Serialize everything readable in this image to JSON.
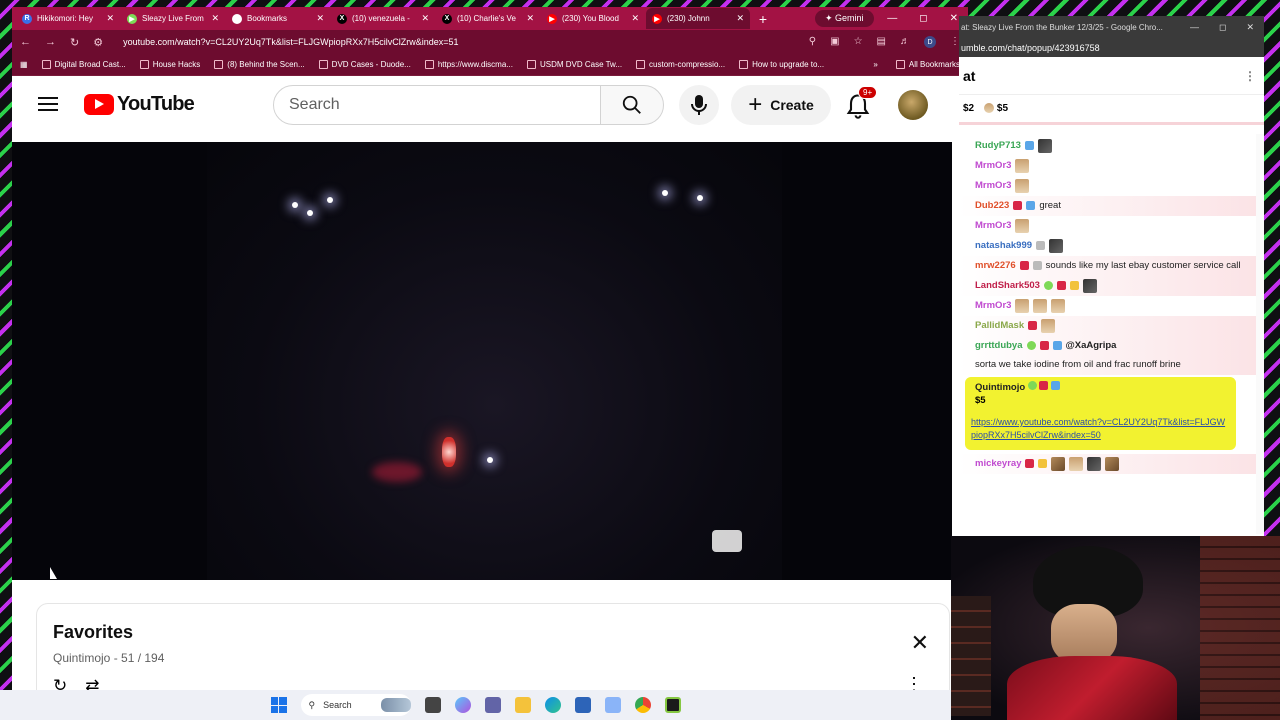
{
  "browser": {
    "tabs": [
      {
        "label": "Hikikomori: Hey",
        "favicon": "R",
        "favcolor": "#3a6fe8",
        "active": false
      },
      {
        "label": "Sleazy Live From",
        "favicon": "▶",
        "favcolor": "#7ed957",
        "active": false
      },
      {
        "label": "Bookmarks",
        "favicon": "★",
        "favcolor": "#ffffff",
        "active": false
      },
      {
        "label": "(10) venezuela -",
        "favicon": "X",
        "favcolor": "#000000",
        "active": false
      },
      {
        "label": "(10) Charlie's Ve",
        "favicon": "X",
        "favcolor": "#000000",
        "active": false
      },
      {
        "label": "(230) You Blood",
        "favicon": "▶",
        "favcolor": "#ff0000",
        "active": false
      },
      {
        "label": "(230) Johnn",
        "favicon": "▶",
        "favcolor": "#ff0000",
        "active": true
      }
    ],
    "new_tab": "+",
    "gemini": "✦ Gemini",
    "url": "youtube.com/watch?v=CL2UY2Uq7Tk&list=FLJGWpiopRXx7H5cilvClZrw&index=51",
    "profile_initial": "D",
    "bookmarks": [
      "Digital Broad Cast...",
      "House Hacks",
      "(8) Behind the Scen...",
      "DVD Cases - Duode...",
      "https://www.discma...",
      "USDM DVD Case Tw...",
      "custom-compressio...",
      "How to upgrade to..."
    ],
    "all_bookmarks": "All Bookmarks",
    "bookmarks_overflow": "»"
  },
  "youtube": {
    "logo_text": "YouTube",
    "search_placeholder": "Search",
    "create_label": "Create",
    "create_plus": "+",
    "notif_badge": "9+"
  },
  "playlist": {
    "title": "Favorites",
    "subtitle": "Quintimojo - 51 / 194",
    "close": "✕",
    "loop_icon": "↻",
    "shuffle_icon": "⇄",
    "more": "⋮"
  },
  "chat": {
    "window_title": "at: Sleazy Live From the Bunker 12/3/25 - Google Chro...",
    "url": "umble.com/chat/popup/423916758",
    "header": "at",
    "more": "⋮",
    "tips": [
      "$2",
      "$5"
    ],
    "messages": [
      {
        "user": "RudyP713",
        "color": "#3aa655",
        "text": "",
        "badges": [
          "blue"
        ],
        "emotes": [
          "dark"
        ],
        "tinted": false
      },
      {
        "user": "MrmOr3",
        "color": "#c04ad0",
        "text": "",
        "badges": [],
        "emotes": [
          "figure"
        ],
        "tinted": false
      },
      {
        "user": "MrmOr3",
        "color": "#c04ad0",
        "text": "",
        "badges": [],
        "emotes": [
          "figure"
        ],
        "tinted": false
      },
      {
        "user": "Dub223",
        "color": "#e0502a",
        "text": "great",
        "badges": [
          "red",
          "blue"
        ],
        "emotes": [],
        "tinted": true
      },
      {
        "user": "MrmOr3",
        "color": "#c04ad0",
        "text": "",
        "badges": [],
        "emotes": [
          "figure"
        ],
        "tinted": false
      },
      {
        "user": "natashak999",
        "color": "#3a6fc0",
        "text": "",
        "badges": [
          "gray"
        ],
        "emotes": [
          "dark"
        ],
        "tinted": false
      },
      {
        "user": "mrw2276",
        "color": "#e0502a",
        "text": "sounds like my last ebay customer service call",
        "badges": [
          "red",
          "gray"
        ],
        "emotes": [],
        "tinted": true
      },
      {
        "user": "LandShark503",
        "color": "#c0204a",
        "text": "",
        "badges": [
          "green",
          "red",
          "yellow"
        ],
        "emotes": [
          "dark"
        ],
        "tinted": true
      },
      {
        "user": "MrmOr3",
        "color": "#c04ad0",
        "text": "",
        "badges": [],
        "emotes": [
          "figure",
          "figure",
          "figure"
        ],
        "tinted": false
      },
      {
        "user": "PallidMask",
        "color": "#8aa84a",
        "text": "",
        "badges": [
          "red"
        ],
        "emotes": [
          "figure"
        ],
        "tinted": true
      },
      {
        "user": "grrttdubya",
        "color": "#3aa655",
        "text": "sorta we take iodine from oil and frac runoff brine",
        "mention": "@XaAgripa",
        "badges": [
          "green",
          "red",
          "blue"
        ],
        "emotes": [],
        "tinted": true
      }
    ],
    "rant": {
      "user": "Quintimojo",
      "amount": "$5",
      "link": "https://www.youtube.com/watch?v=CL2UY2Uq7Tk&list=FLJGWpiopRXx7H5cilvClZrw&index=50"
    },
    "last_user": "mickeyray"
  },
  "taskbar": {
    "search_label": "Search"
  }
}
